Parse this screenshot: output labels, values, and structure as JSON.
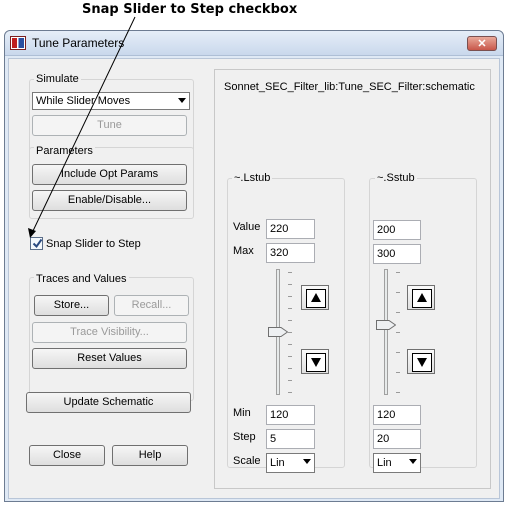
{
  "annotation": {
    "text": "Snap Slider to Step checkbox"
  },
  "window": {
    "title": "Tune Parameters",
    "close_glyph": "✕"
  },
  "simulate": {
    "label": "Simulate",
    "mode_value": "While Slider Moves",
    "tune_label": "Tune"
  },
  "parameters": {
    "label": "Parameters",
    "include_opt_label": "Include Opt Params",
    "enable_disable_label": "Enable/Disable..."
  },
  "snap": {
    "label": "Snap Slider to Step",
    "checked": true
  },
  "traces": {
    "label": "Traces and Values",
    "store_label": "Store...",
    "recall_label": "Recall...",
    "trace_visibility_label": "Trace Visibility...",
    "reset_label": "Reset Values"
  },
  "update_schematic_label": "Update Schematic",
  "close_label": "Close",
  "help_label": "Help",
  "schematic_path": "Sonnet_SEC_Filter_lib:Tune_SEC_Filter:schematic",
  "field_labels": {
    "value": "Value",
    "max": "Max",
    "min": "Min",
    "step": "Step",
    "scale": "Scale"
  },
  "params": [
    {
      "name": "~.Lstub",
      "value": "220",
      "max": "320",
      "min": "120",
      "step": "5",
      "scale": "Lin",
      "slider_fraction": 0.5
    },
    {
      "name": "~.Sstub",
      "value": "200",
      "max": "300",
      "min": "120",
      "step": "20",
      "scale": "Lin",
      "slider_fraction": 0.44
    }
  ],
  "colors": {
    "accent": "#dfe9f5",
    "close_button": "#c8574a"
  },
  "icons": {
    "app": "app-logo-icon",
    "close": "close-icon",
    "dropdown": "chevron-down-icon",
    "up": "arrow-up-icon",
    "down": "arrow-down-icon"
  }
}
